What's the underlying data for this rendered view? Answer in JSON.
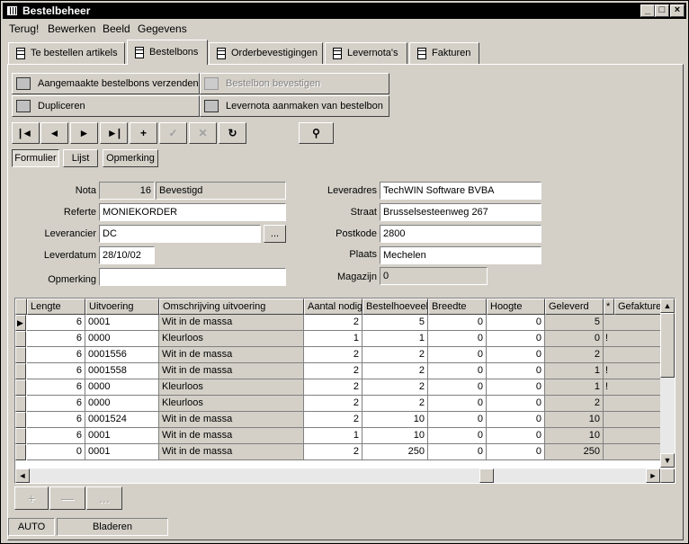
{
  "window": {
    "title": "Bestelbeheer",
    "controls": {
      "minimize": "_",
      "maximize": "□",
      "close": "×"
    }
  },
  "menu": [
    "Terug!",
    "Bewerken",
    "Beeld",
    "Gegevens"
  ],
  "tabs": [
    "Te bestellen artikels",
    "Bestelbons",
    "Orderbevestigingen",
    "Levernota's",
    "Fakturen"
  ],
  "active_tab": "Bestelbons",
  "actions": {
    "send": "Aangemaakte bestelbons verzenden..",
    "confirm": "Bestelbon bevestigen",
    "duplicate": "Dupliceren",
    "create_delivery": "Levernota aanmaken van bestelbon"
  },
  "nav": {
    "first": "|◄",
    "prev": "◄",
    "next": "►",
    "last": "►|",
    "add": "+",
    "save": "✓",
    "cancel": "✕",
    "refresh": "↻",
    "find": "⚲"
  },
  "view_tabs": [
    "Formulier",
    "Lijst",
    "Opmerking"
  ],
  "form": {
    "nota_label": "Nota",
    "nota": "16",
    "status": "Bevestigd",
    "referte_label": "Referte",
    "referte": "MONIEKORDER",
    "leverancier_label": "Leverancier",
    "leverancier": "DC",
    "browse": "...",
    "leverdatum_label": "Leverdatum",
    "leverdatum": "28/10/02",
    "opmerking_label": "Opmerking",
    "opmerking": "",
    "leveradres_label": "Leveradres",
    "leveradres": "TechWIN Software BVBA",
    "straat_label": "Straat",
    "straat": "Brusselsesteenweg 267",
    "postkode_label": "Postkode",
    "postkode": "2800",
    "plaats_label": "Plaats",
    "plaats": "Mechelen",
    "magazijn_label": "Magazijn",
    "magazijn": "0"
  },
  "grid": {
    "columns": [
      "Lengte",
      "Uitvoering",
      "Omschrijving uitvoering",
      "Aantal nodig",
      "Bestelhoeveelh",
      "Breedte",
      "Hoogte",
      "Geleverd",
      "*",
      "Gefakturee"
    ],
    "rows": [
      [
        "6",
        "0001",
        "Wit in de massa",
        "2",
        "5",
        "0",
        "0",
        "5",
        ""
      ],
      [
        "6",
        "0000",
        "Kleurloos",
        "1",
        "1",
        "0",
        "0",
        "0",
        "!"
      ],
      [
        "6",
        "0001556",
        "Wit in de massa",
        "2",
        "2",
        "0",
        "0",
        "2",
        ""
      ],
      [
        "6",
        "0001558",
        "Wit in de massa",
        "2",
        "2",
        "0",
        "0",
        "1",
        "!"
      ],
      [
        "6",
        "0000",
        "Kleurloos",
        "2",
        "2",
        "0",
        "0",
        "1",
        "!"
      ],
      [
        "6",
        "0000",
        "Kleurloos",
        "2",
        "2",
        "0",
        "0",
        "2",
        ""
      ],
      [
        "6",
        "0001524",
        "Wit in de massa",
        "2",
        "10",
        "0",
        "0",
        "10",
        ""
      ],
      [
        "6",
        "0001",
        "Wit in de massa",
        "1",
        "10",
        "0",
        "0",
        "10",
        ""
      ],
      [
        "0",
        "0001",
        "Wit in de massa",
        "2",
        "250",
        "0",
        "0",
        "250",
        ""
      ]
    ],
    "current_row_marker": "▶",
    "scroll": {
      "up": "▲",
      "down": "▼",
      "left": "◄",
      "right": "►"
    }
  },
  "subgrid_buttons": {
    "add": "+",
    "remove": "—",
    "more": "..."
  },
  "status": {
    "mode": "AUTO",
    "state": "Bladeren"
  }
}
